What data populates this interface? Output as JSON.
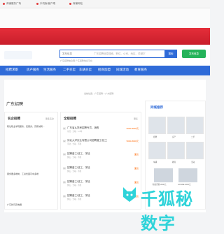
{
  "topbar": {
    "items": [
      "商铺服务广场",
      "手机版/客户端",
      "商铺网站"
    ]
  },
  "search": {
    "category": "发布信息",
    "placeholder": "广东招聘信息搜索，职位、公司、地区、关键字",
    "button": "搜索",
    "hot_text": "广东招聘信息网 广东招聘信息平台"
  },
  "publish_button": "发布信息",
  "nav": {
    "tabs": [
      "招聘求职",
      "房产服务",
      "生活服务",
      "二手买卖",
      "车辆买卖",
      "招商加盟",
      "同城活动",
      "教育服务"
    ]
  },
  "breadcrumb": "当前位置：广东招聘 > 广州招聘",
  "page_title": "广东招聘",
  "left_panel": {
    "title": "名企招聘",
    "more": "更多名企",
    "items": [
      "职位职业学院服务，佳服务，高薪诚聘...",
      "服务要多端岗，工资优面可中多端",
      "广东新月亮电器"
    ]
  },
  "mid_panel": {
    "title": "全职招聘",
    "more": "更多",
    "rows": [
      {
        "n": "01",
        "title": "广东省从贷房招聘专员，销售",
        "meta": "东莞 · 全职 · 1-3年",
        "salary": "5000-8000元"
      },
      {
        "n": "02",
        "title": "河北大洋实业有限公司招聘普工/技工",
        "meta": "河北 · 全职 · 不限",
        "salary": "5000-8000元"
      },
      {
        "n": "03",
        "title": "招聘普工/技工、学徒",
        "meta": "佛山 · 全职 · 不限",
        "salary": "面议"
      },
      {
        "n": "04",
        "title": "招聘普工/技工、学徒",
        "meta": "佛山 · 全职 · 不限",
        "salary": "面议"
      },
      {
        "n": "05",
        "title": "招聘普工/技工、学徒",
        "meta": "佛山 · 全职 · 不限",
        "salary": "面议"
      },
      {
        "n": "06",
        "title": "招聘普工/技工、学徒",
        "meta": "佛山 · 全职 · 不限",
        "salary": "面议"
      }
    ]
  },
  "right_panel": {
    "title": "同城推荐",
    "cards": [
      "招聘",
      "房产",
      "二手",
      "车辆",
      "教育",
      "活动"
    ],
    "thumb_captions": [
      "职位月薪 2000元",
      "ACSWE 2000元"
    ]
  },
  "watermark": {
    "text": "千狐秘数字"
  },
  "colors": {
    "brand_red": "#e52e3a",
    "nav_blue": "#2f6bd8",
    "publish_green": "#25b35a",
    "watermark_cyan": "#2ed3d9"
  }
}
